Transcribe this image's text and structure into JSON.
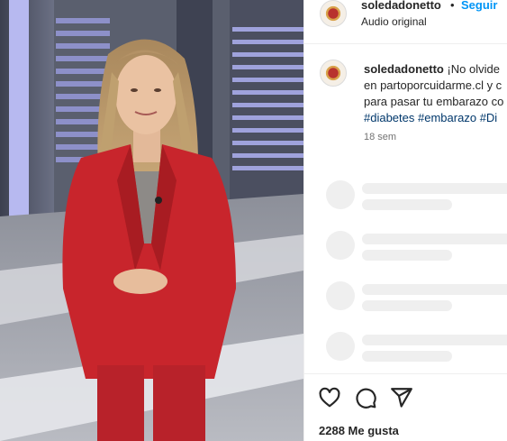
{
  "post": {
    "username": "soledadonetto",
    "separator": "•",
    "follow_label": "Seguir",
    "audio": "Audio original",
    "caption": {
      "username": "soledadonetto",
      "line1": "¡No olvide",
      "line2": "en partoporcuidarme.cl y c",
      "line3": "para pasar tu embarazo co",
      "hashtags": [
        "#diabetes",
        "#embarazo",
        "#Di"
      ]
    },
    "timestamp": "18 sem",
    "likes": "2288 Me gusta"
  },
  "icons": {
    "like": "heart-outline-icon",
    "comment": "comment-bubble-icon",
    "share": "paper-plane-icon",
    "avatar": "profile-avatar"
  },
  "colors": {
    "follow": "#0095f6",
    "hashtag": "#00376b",
    "skeleton": "#efefef",
    "blazer": "#c8252c"
  }
}
